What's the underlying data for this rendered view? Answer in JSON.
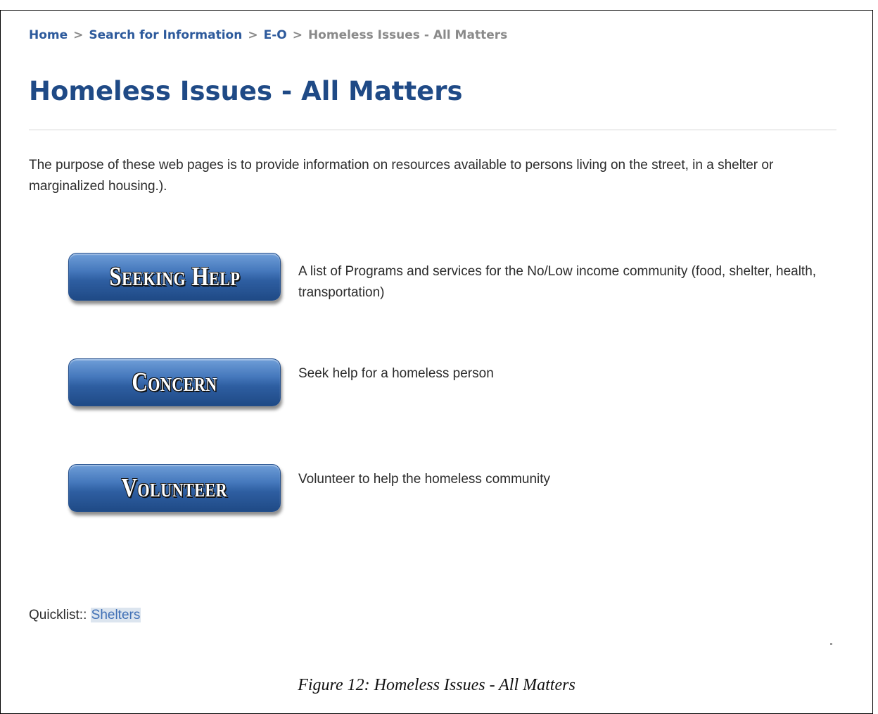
{
  "breadcrumb": {
    "items": [
      "Home",
      "Search for Information",
      "E-O"
    ],
    "separator": ">",
    "current": "Homeless Issues - All Matters"
  },
  "page": {
    "title": "Homeless Issues - All Matters",
    "intro": "The purpose of these web pages is to provide information on resources available to persons living on the street, in a shelter or marginalized housing.)."
  },
  "actions": [
    {
      "label": "Seeking Help",
      "description": "A list of Programs and services for the No/Low income community (food, shelter, health, transportation)"
    },
    {
      "label": "Concern",
      "description": "Seek help for a homeless person"
    },
    {
      "label": "Volunteer",
      "description": "Volunteer to help the homeless community"
    }
  ],
  "quicklist": {
    "label": "Quicklist::",
    "link": "Shelters"
  },
  "caption": "Figure 12: Homeless Issues - All Matters",
  "colors": {
    "link_blue": "#2d5a9c",
    "title_blue": "#1f4a86",
    "button_blue": "#2e5ea1",
    "breadcrumb_gray": "#8a8a8a"
  }
}
